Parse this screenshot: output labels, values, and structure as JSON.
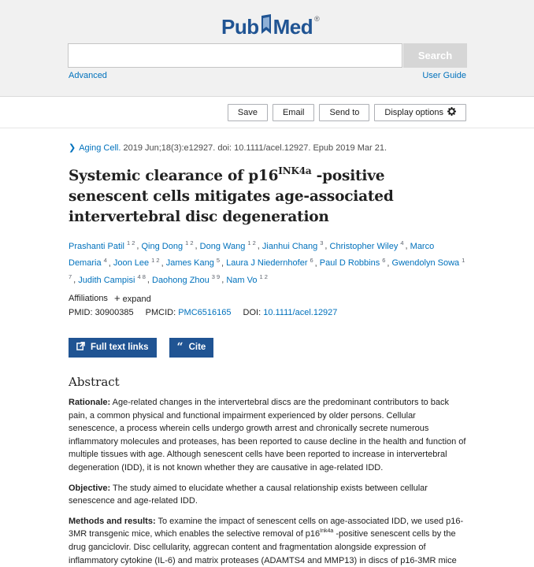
{
  "header": {
    "logo_text_left": "Pub",
    "logo_text_right": "Med",
    "logo_reg": "®",
    "search_placeholder": "",
    "search_button": "Search",
    "advanced": "Advanced",
    "user_guide": "User Guide"
  },
  "toolbar": {
    "save": "Save",
    "email": "Email",
    "send_to": "Send to",
    "display_options": "Display options"
  },
  "article": {
    "journal": "Aging Cell.",
    "citation_rest": " 2019 Jun;18(3):e12927. doi: 10.1111/acel.12927. Epub 2019 Mar 21.",
    "title_pre": "Systemic clearance of p16",
    "title_sup": "INK4a",
    "title_post": " -positive senescent cells mitigates age-associated intervertebral disc degeneration",
    "authors": [
      {
        "name": "Prashanti Patil",
        "aff": "1 2"
      },
      {
        "name": "Qing Dong",
        "aff": "1 2"
      },
      {
        "name": "Dong Wang",
        "aff": "1 2"
      },
      {
        "name": "Jianhui Chang",
        "aff": "3"
      },
      {
        "name": "Christopher Wiley",
        "aff": "4"
      },
      {
        "name": "Marco Demaria",
        "aff": "4"
      },
      {
        "name": "Joon Lee",
        "aff": "1 2"
      },
      {
        "name": "James Kang",
        "aff": "5"
      },
      {
        "name": "Laura J Niedernhofer",
        "aff": "6"
      },
      {
        "name": "Paul D Robbins",
        "aff": "6"
      },
      {
        "name": "Gwendolyn Sowa",
        "aff": "1 7"
      },
      {
        "name": "Judith Campisi",
        "aff": "4 8"
      },
      {
        "name": "Daohong Zhou",
        "aff": "3 9"
      },
      {
        "name": "Nam Vo",
        "aff": "1 2"
      }
    ],
    "affiliations_label": "Affiliations",
    "expand_label": "expand",
    "pmid_label": "PMID: ",
    "pmid": "30900385",
    "pmcid_label": "PMCID: ",
    "pmcid": "PMC6516165",
    "doi_label": "DOI: ",
    "doi": "10.1111/acel.12927"
  },
  "buttons": {
    "full_text": "Full text links",
    "cite": "Cite"
  },
  "abstract": {
    "heading": "Abstract",
    "rationale_label": "Rationale:",
    "rationale": " Age-related changes in the intervertebral discs are the predominant contributors to back pain, a common physical and functional impairment experienced by older persons. Cellular senescence, a process wherein cells undergo growth arrest and chronically secrete numerous inflammatory molecules and proteases, has been reported to cause decline in the health and function of multiple tissues with age. Although senescent cells have been reported to increase in intervertebral degeneration (IDD), it is not known whether they are causative in age-related IDD.",
    "objective_label": "Objective:",
    "objective": " The study aimed to elucidate whether a causal relationship exists between cellular senescence and age-related IDD.",
    "methods_label": "Methods and results:",
    "methods_pre": " To examine the impact of senescent cells on age-associated IDD, we used p16-3MR transgenic mice, which enables the selective removal of p16",
    "methods_sup": "Ink4a",
    "methods_post": " -positive senescent cells by the drug ganciclovir. Disc cellularity, aggrecan content and fragmentation alongside expression of inflammatory cytokine (IL-6) and matrix proteases (ADAMTS4 and MMP13) in discs of p16-3MR mice"
  }
}
